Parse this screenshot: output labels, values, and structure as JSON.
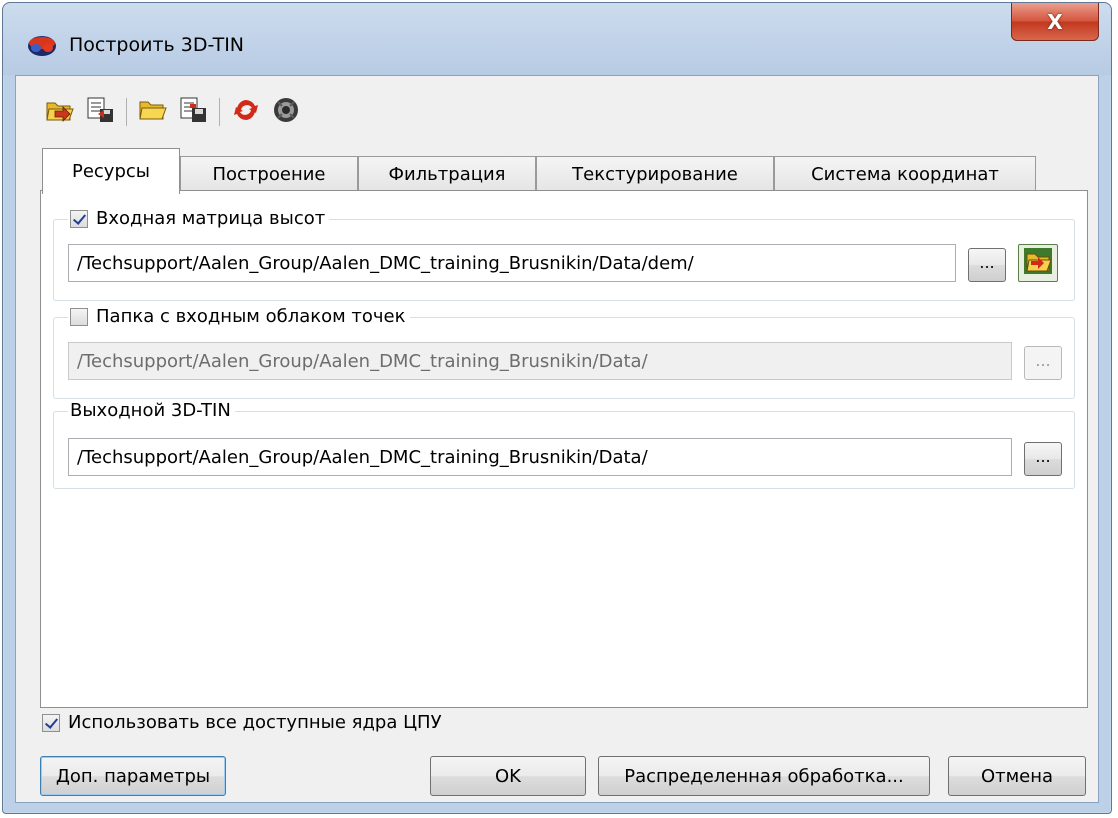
{
  "window": {
    "title": "Построить 3D-TIN",
    "close_label": "X"
  },
  "toolbar": {
    "buttons": [
      {
        "icon": "load-settings-icon"
      },
      {
        "icon": "save-settings-icon"
      },
      {
        "icon": "open-folder-icon"
      },
      {
        "icon": "save-as-icon"
      },
      {
        "icon": "refresh-icon"
      },
      {
        "icon": "reset-icon"
      }
    ]
  },
  "tabs": [
    {
      "label": "Ресурсы",
      "active": true
    },
    {
      "label": "Построение",
      "active": false
    },
    {
      "label": "Фильтрация",
      "active": false
    },
    {
      "label": "Текстурирование",
      "active": false
    },
    {
      "label": "Система координат",
      "active": false
    }
  ],
  "resources": {
    "input_matrix": {
      "label": "Входная матрица высот",
      "checked": true,
      "path": "/Techsupport/Aalen_Group/Aalen_DMC_training_Brusnikin/Data/dem/",
      "browse_label": "..."
    },
    "point_cloud": {
      "label": "Папка с входным облаком точек",
      "checked": false,
      "path": "/Techsupport/Aalen_Group/Aalen_DMC_training_Brusnikin/Data/",
      "browse_label": "..."
    },
    "output_tin": {
      "label": "Выходной 3D-TIN",
      "path": "/Techsupport/Aalen_Group/Aalen_DMC_training_Brusnikin/Data/",
      "browse_label": "..."
    }
  },
  "use_all_cores": {
    "label": "Использовать все доступные ядра ЦПУ",
    "checked": true
  },
  "buttons": {
    "advanced": "Доп. параметры",
    "ok": "OK",
    "distributed": "Распределенная обработка...",
    "cancel": "Отмена"
  },
  "colors": {
    "titlebar": "#bcd0e8",
    "close_button": "#c2391f",
    "panel_bg": "#f0f0f0"
  }
}
